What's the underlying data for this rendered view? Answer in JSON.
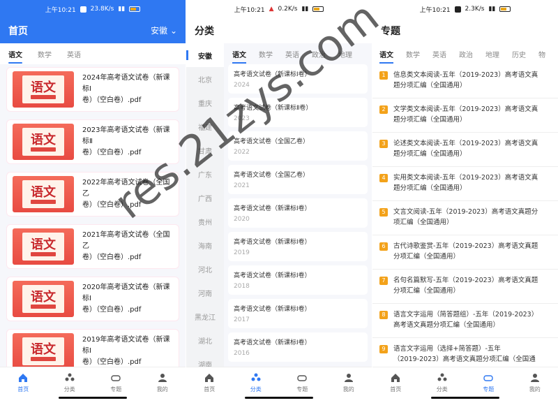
{
  "status": {
    "s1": {
      "time": "上午10:21",
      "speed": "23.8K/s"
    },
    "s2": {
      "time": "上午10:21",
      "speed": "0.2K/s"
    },
    "s3": {
      "time": "上午10:21",
      "speed": "2.3K/s"
    },
    "battery": "50"
  },
  "home": {
    "title": "首页",
    "location": "安徽",
    "tabs": [
      "语文",
      "数学",
      "英语"
    ],
    "thumb_glyph": "语文",
    "docs": [
      {
        "line1": "2024年高考语文试卷（新课标Ⅰ",
        "line2": "卷）（空白卷）.pdf"
      },
      {
        "line1": "2023年高考语文试卷（新课标Ⅱ",
        "line2": "卷）（空白卷）.pdf"
      },
      {
        "line1": "2022年高考语文试卷（全国乙",
        "line2": "卷）（空白卷）.pdf"
      },
      {
        "line1": "2021年高考语文试卷（全国乙",
        "line2": "卷）（空白卷）.pdf"
      },
      {
        "line1": "2020年高考语文试卷（新课标Ⅰ",
        "line2": "卷）（空白卷）.pdf"
      },
      {
        "line1": "2019年高考语文试卷（新课标Ⅰ",
        "line2": "卷）（空白卷）.pdf"
      }
    ]
  },
  "category": {
    "title": "分类",
    "provinces": [
      "安徽",
      "北京",
      "重庆",
      "福建",
      "甘肃",
      "广东",
      "广西",
      "贵州",
      "海南",
      "河北",
      "河南",
      "黑龙江",
      "湖北",
      "湖南"
    ],
    "tabs": [
      "语文",
      "数学",
      "英语",
      "政治",
      "地理"
    ],
    "exams": [
      {
        "title": "高考语文试卷（新课标Ⅰ卷）",
        "year": "2024"
      },
      {
        "title": "高考语文试卷（新课标Ⅱ卷）",
        "year": "2023"
      },
      {
        "title": "高考语文试卷（全国乙卷）",
        "year": "2022"
      },
      {
        "title": "高考语文试卷（全国乙卷）",
        "year": "2021"
      },
      {
        "title": "高考语文试卷（新课标Ⅰ卷）",
        "year": "2020"
      },
      {
        "title": "高考语文试卷（新课标Ⅰ卷）",
        "year": "2019"
      },
      {
        "title": "高考语文试卷（新课标Ⅰ卷）",
        "year": "2018"
      },
      {
        "title": "高考语文试卷（新课标Ⅰ卷）",
        "year": "2017"
      },
      {
        "title": "高考语文试卷（新课标Ⅰ卷）",
        "year": "2016"
      }
    ]
  },
  "topics": {
    "title": "专题",
    "tabs": [
      "语文",
      "数学",
      "英语",
      "政治",
      "地理",
      "历史",
      "物"
    ],
    "items": [
      {
        "num": "1",
        "l1": "信息类文本阅读-五年（2019-2023）高考语文真",
        "l2": "题分项汇编（全国通用）"
      },
      {
        "num": "2",
        "l1": "文学类文本阅读-五年（2019-2023）高考语文真",
        "l2": "题分项汇编（全国通用）"
      },
      {
        "num": "3",
        "l1": "论述类文本阅读-五年（2019-2023）高考语文真",
        "l2": "题分项汇编（全国通用）"
      },
      {
        "num": "4",
        "l1": "实用类文本阅读-五年（2019-2023）高考语文真",
        "l2": "题分项汇编（全国通用）"
      },
      {
        "num": "5",
        "l1": "文言文阅读-五年（2019-2023）高考语文真题分",
        "l2": "项汇编（全国通用）"
      },
      {
        "num": "6",
        "l1": "古代诗歌鉴赏-五年（2019-2023）高考语文真题",
        "l2": "分项汇编（全国通用）"
      },
      {
        "num": "7",
        "l1": "名句名篇默写-五年（2019-2023）高考语文真题",
        "l2": "分项汇编（全国通用）"
      },
      {
        "num": "8",
        "l1": "语言文字运用（简答题组）-五年（2019-2023）",
        "l2": "高考语文真题分项汇编（全国通用）"
      },
      {
        "num": "9",
        "l1": "语言文字运用（选择+简答题）-五年",
        "l2": "（2019-2023）高考语文真题分项汇编（全国通"
      }
    ]
  },
  "nav": [
    "首页",
    "分类",
    "专题",
    "我的"
  ],
  "watermark": "res.21zys.com",
  "colors": {
    "accent": "#2f78f2",
    "badge": "#f3a21a",
    "thumb": "#e84b42"
  }
}
